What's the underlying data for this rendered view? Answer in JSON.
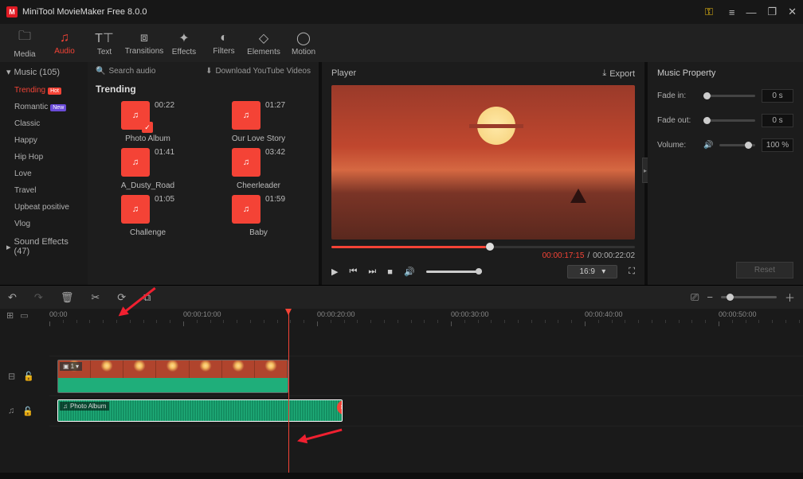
{
  "app": {
    "title": "MiniTool MovieMaker Free 8.0.0"
  },
  "ribbon": {
    "tabs": [
      {
        "id": "media",
        "label": "Media"
      },
      {
        "id": "audio",
        "label": "Audio"
      },
      {
        "id": "text",
        "label": "Text"
      },
      {
        "id": "transitions",
        "label": "Transitions"
      },
      {
        "id": "effects",
        "label": "Effects"
      },
      {
        "id": "filters",
        "label": "Filters"
      },
      {
        "id": "elements",
        "label": "Elements"
      },
      {
        "id": "motion",
        "label": "Motion"
      }
    ]
  },
  "library": {
    "groups": [
      {
        "label": "Music",
        "count": 105,
        "expanded": true
      },
      {
        "label": "Sound Effects",
        "count": 47,
        "expanded": false
      }
    ],
    "items": [
      {
        "label": "Trending",
        "badge": "Hot",
        "active": true
      },
      {
        "label": "Romantic",
        "badge": "New"
      },
      {
        "label": "Classic"
      },
      {
        "label": "Happy"
      },
      {
        "label": "Hip Hop"
      },
      {
        "label": "Love"
      },
      {
        "label": "Travel"
      },
      {
        "label": "Upbeat positive"
      },
      {
        "label": "Vlog"
      }
    ]
  },
  "audio": {
    "search_placeholder": "Search audio",
    "download_label": "Download YouTube Videos",
    "section": "Trending",
    "tiles": [
      {
        "name": "Photo Album",
        "dur": "00:22",
        "checked": true
      },
      {
        "name": "Our Love Story",
        "dur": "01:27"
      },
      {
        "name": "A_Dusty_Road",
        "dur": "01:41"
      },
      {
        "name": "Cheerleader",
        "dur": "03:42"
      },
      {
        "name": "Challenge",
        "dur": "01:05"
      },
      {
        "name": "Baby",
        "dur": "01:59"
      }
    ]
  },
  "player": {
    "title": "Player",
    "export": "Export",
    "current": "00:00:17:15",
    "total": "00:00:22:02",
    "ratio": "16:9"
  },
  "props": {
    "title": "Music Property",
    "fade_in_label": "Fade in:",
    "fade_in_val": "0 s",
    "fade_out_label": "Fade out:",
    "fade_out_val": "0 s",
    "volume_label": "Volume:",
    "volume_val": "100 %",
    "reset": "Reset"
  },
  "ruler": {
    "marks": [
      "00:00",
      "00:00:10:00",
      "00:00:20:00",
      "00:00:30:00",
      "00:00:40:00",
      "00:00:50:00"
    ]
  },
  "timeline": {
    "video_clip_count": "1",
    "audio_clip_name": "Photo Album"
  }
}
